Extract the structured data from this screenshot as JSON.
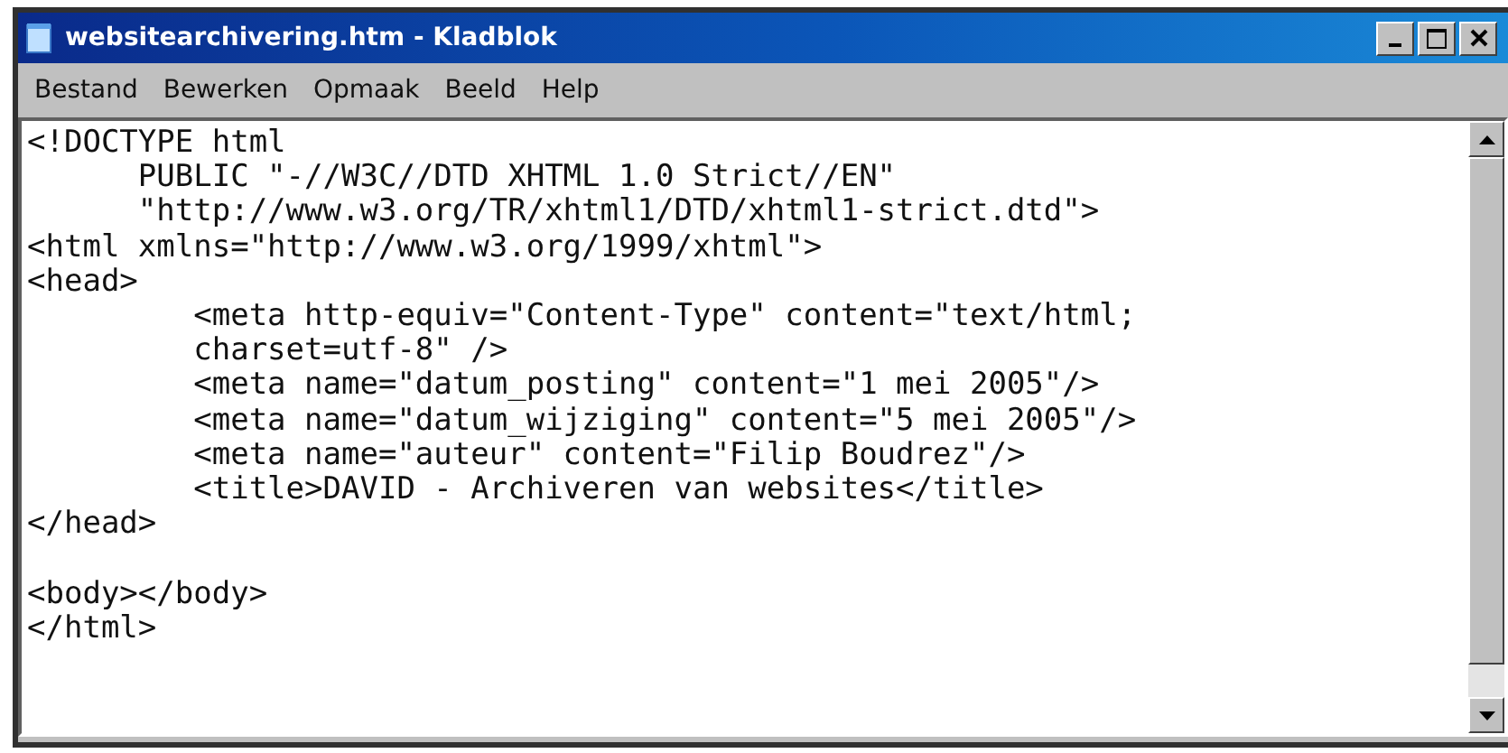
{
  "window": {
    "title": "websitearchivering.htm - Kladblok"
  },
  "menu": [
    "Bestand",
    "Bewerken",
    "Opmaak",
    "Beeld",
    "Help"
  ],
  "lines": [
    {
      "text": "<!DOCTYPE html",
      "space_before": false
    },
    {
      "text": "      PUBLIC \"-//W3C//DTD XHTML 1.0 Strict//EN\"",
      "space_before": false
    },
    {
      "text": "      \"http://www.w3.org/TR/xhtml1/DTD/xhtml1-strict.dtd\">",
      "space_before": false
    },
    {
      "text": "<html xmlns=\"http://www.w3.org/1999/xhtml\">",
      "space_before": false
    },
    {
      "text": "<head>",
      "space_before": false
    },
    {
      "text": "         <meta http-equiv=\"Content-Type\" content=\"text/html;",
      "space_before": false
    },
    {
      "text": "         charset=utf-8\" />",
      "space_before": false
    },
    {
      "text": "         <meta name=\"datum_posting\" content=\"1 mei 2005\"/>",
      "space_before": false
    },
    {
      "text": "         <meta name=\"datum_wijziging\" content=\"5 mei 2005\"/>",
      "space_before": false
    },
    {
      "text": "         <meta name=\"auteur\" content=\"Filip Boudrez\"/>",
      "space_before": false
    },
    {
      "text": "         <title>DAVID - Archiveren van websites</title>",
      "space_before": false
    },
    {
      "text": "</head>",
      "space_before": false
    },
    {
      "text": "<body></body>",
      "space_before": true
    },
    {
      "text": "</html>",
      "space_before": false
    }
  ]
}
